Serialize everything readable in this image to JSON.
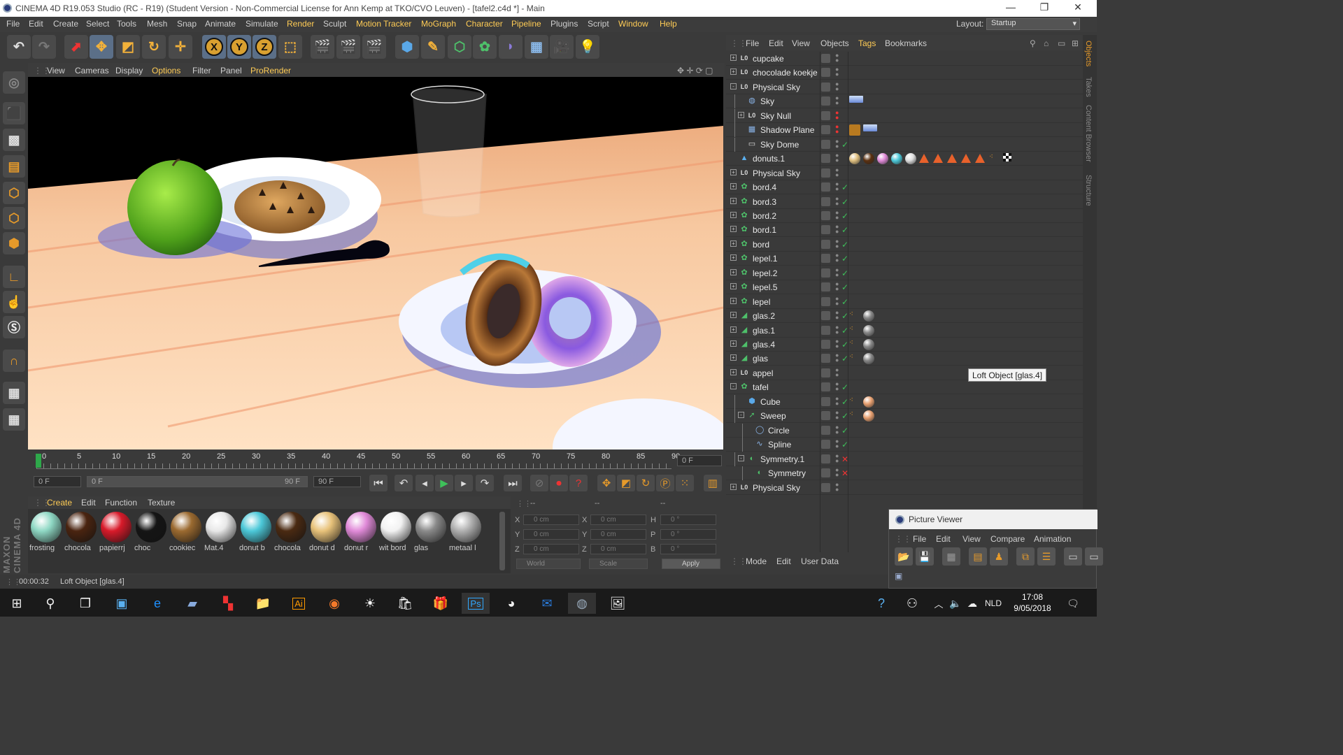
{
  "title": "CINEMA 4D R19.053 Studio (RC - R19) (Student Version - Non-Commercial License for Ann Kemp at TKO/CVO Leuven) - [tafel2.c4d *] - Main",
  "menu": [
    "File",
    "Edit",
    "Create",
    "Select",
    "Tools",
    "Mesh",
    "Snap",
    "Animate",
    "Simulate",
    "Sculpt",
    "Render",
    "Sculpt",
    "Motion Tracker",
    "MoGraph",
    "Character",
    "Pipeline",
    "Plugins",
    "Script",
    "Window",
    "Help"
  ],
  "layout_label": "Layout:",
  "layout_value": "Startup",
  "viewport_menu": [
    "View",
    "Cameras",
    "Display",
    "Options",
    "Filter",
    "Panel",
    "ProRender"
  ],
  "timeline": {
    "ticks": [
      "0",
      "5",
      "10",
      "15",
      "20",
      "25",
      "30",
      "35",
      "40",
      "45",
      "50",
      "55",
      "60",
      "65",
      "70",
      "75",
      "80",
      "85",
      "90"
    ],
    "current_frame": "0 F",
    "start_field": "0 F",
    "range_start": "0 F",
    "range_end": "90 F",
    "end_field": "90 F"
  },
  "material_menu": [
    "Create",
    "Edit",
    "Function",
    "Texture"
  ],
  "materials": [
    {
      "name": "frosting",
      "color": "#8fd8c4"
    },
    {
      "name": "chocola",
      "color": "#4a2410"
    },
    {
      "name": "papierrj",
      "color": "#d81a2a"
    },
    {
      "name": "choc",
      "color": "#151515"
    },
    {
      "name": "cookiec",
      "color": "#9b6a30"
    },
    {
      "name": "Mat.4",
      "color": "#e8e8e8"
    },
    {
      "name": "donut b",
      "color": "#4cc8d8"
    },
    {
      "name": "chocola",
      "color": "#4a2a12"
    },
    {
      "name": "donut d",
      "color": "#e8c27a"
    },
    {
      "name": "donut r",
      "color": "#e08ad8"
    },
    {
      "name": "wit bord",
      "color": "#f2f2f2"
    },
    {
      "name": "glas",
      "color": "#8a8a8a"
    },
    {
      "name": "metaal l",
      "color": "#b0b0b0"
    }
  ],
  "attributes": {
    "headers": [
      "--",
      "--",
      "--"
    ],
    "rows": [
      [
        "X",
        "0 cm",
        "X",
        "0 cm",
        "H",
        "0 °"
      ],
      [
        "Y",
        "0 cm",
        "Y",
        "0 cm",
        "P",
        "0 °"
      ],
      [
        "Z",
        "0 cm",
        "Z",
        "0 cm",
        "B",
        "0 °"
      ]
    ],
    "world": "World",
    "scale": "Scale",
    "apply": "Apply"
  },
  "status": {
    "time": "00:00:32",
    "message": "Loft Object [glas.4]"
  },
  "object_menu": [
    "File",
    "Edit",
    "View",
    "Objects",
    "Tags",
    "Bookmarks"
  ],
  "objects": [
    {
      "name": "cupcake",
      "indent": 0,
      "icon": "null",
      "expand": "+",
      "check": ""
    },
    {
      "name": "chocolade koekje",
      "indent": 0,
      "icon": "null",
      "expand": "+",
      "check": ""
    },
    {
      "name": "Physical Sky",
      "indent": 0,
      "icon": "null",
      "expand": "-",
      "check": ""
    },
    {
      "name": "Sky",
      "indent": 1,
      "icon": "sky",
      "expand": "",
      "check": "",
      "tags": [
        "skytag"
      ]
    },
    {
      "name": "Sky Null",
      "indent": 1,
      "icon": "null",
      "expand": "+",
      "check": "dot"
    },
    {
      "name": "Shadow Plane",
      "indent": 1,
      "icon": "plane",
      "expand": "",
      "check": "dot",
      "tags": [
        "comp",
        "skytag"
      ]
    },
    {
      "name": "Sky Dome",
      "indent": 1,
      "icon": "dome",
      "expand": "",
      "check": "v"
    },
    {
      "name": "donuts.1",
      "indent": 0,
      "icon": "cloner",
      "expand": "",
      "check": "",
      "tags": [
        "m1",
        "m2",
        "m3",
        "m4",
        "m5",
        "t",
        "t",
        "t",
        "t",
        "t",
        "p",
        "chk"
      ]
    },
    {
      "name": "Physical Sky",
      "indent": 0,
      "icon": "null",
      "expand": "+",
      "check": ""
    },
    {
      "name": "bord.4",
      "indent": 0,
      "icon": "gen",
      "expand": "+",
      "check": "v"
    },
    {
      "name": "bord.3",
      "indent": 0,
      "icon": "gen",
      "expand": "+",
      "check": "v"
    },
    {
      "name": "bord.2",
      "indent": 0,
      "icon": "gen",
      "expand": "+",
      "check": "v"
    },
    {
      "name": "bord.1",
      "indent": 0,
      "icon": "gen",
      "expand": "+",
      "check": "v"
    },
    {
      "name": "bord",
      "indent": 0,
      "icon": "gen",
      "expand": "+",
      "check": "v"
    },
    {
      "name": "lepel.1",
      "indent": 0,
      "icon": "gen",
      "expand": "+",
      "check": "v"
    },
    {
      "name": "lepel.2",
      "indent": 0,
      "icon": "gen",
      "expand": "+",
      "check": "v"
    },
    {
      "name": "lepel.5",
      "indent": 0,
      "icon": "gen",
      "expand": "+",
      "check": "v"
    },
    {
      "name": "lepel",
      "indent": 0,
      "icon": "gen",
      "expand": "+",
      "check": "v"
    },
    {
      "name": "glas.2",
      "indent": 0,
      "icon": "loft",
      "expand": "+",
      "check": "v",
      "tags": [
        "p",
        "g"
      ]
    },
    {
      "name": "glas.1",
      "indent": 0,
      "icon": "loft",
      "expand": "+",
      "check": "v",
      "tags": [
        "p",
        "g"
      ]
    },
    {
      "name": "glas.4",
      "indent": 0,
      "icon": "loft",
      "expand": "+",
      "check": "v",
      "tags": [
        "p",
        "g"
      ]
    },
    {
      "name": "glas",
      "indent": 0,
      "icon": "loft",
      "expand": "+",
      "check": "v",
      "tags": [
        "p",
        "g"
      ]
    },
    {
      "name": "appel",
      "indent": 0,
      "icon": "null",
      "expand": "+",
      "check": ""
    },
    {
      "name": "tafel",
      "indent": 0,
      "icon": "gen",
      "expand": "-",
      "check": "v"
    },
    {
      "name": "Cube",
      "indent": 1,
      "icon": "cube",
      "expand": "",
      "check": "v",
      "tags": [
        "p",
        "wood"
      ]
    },
    {
      "name": "Sweep",
      "indent": 1,
      "icon": "sweep",
      "expand": "-",
      "check": "v",
      "tags": [
        "p",
        "wood"
      ]
    },
    {
      "name": "Circle",
      "indent": 2,
      "icon": "circle",
      "expand": "",
      "check": "v"
    },
    {
      "name": "Spline",
      "indent": 2,
      "icon": "spline",
      "expand": "",
      "check": "v"
    },
    {
      "name": "Symmetry.1",
      "indent": 1,
      "icon": "sym",
      "expand": "-",
      "check": "x"
    },
    {
      "name": "Symmetry",
      "indent": 2,
      "icon": "sym",
      "expand": "",
      "check": "x"
    },
    {
      "name": "Physical Sky",
      "indent": 0,
      "icon": "null",
      "expand": "+",
      "check": ""
    }
  ],
  "tooltip": "Loft Object [glas.4]",
  "sidebar_tabs": [
    "Objects",
    "Takes",
    "Content Browser",
    "Structure"
  ],
  "mode_menu": [
    "Mode",
    "Edit",
    "User Data"
  ],
  "picture_viewer": {
    "title": "Picture Viewer",
    "menu": [
      "File",
      "Edit",
      "View",
      "Compare",
      "Animation"
    ]
  },
  "taskbar": {
    "lang": "NLD",
    "time": "17:08",
    "date": "9/05/2018"
  }
}
